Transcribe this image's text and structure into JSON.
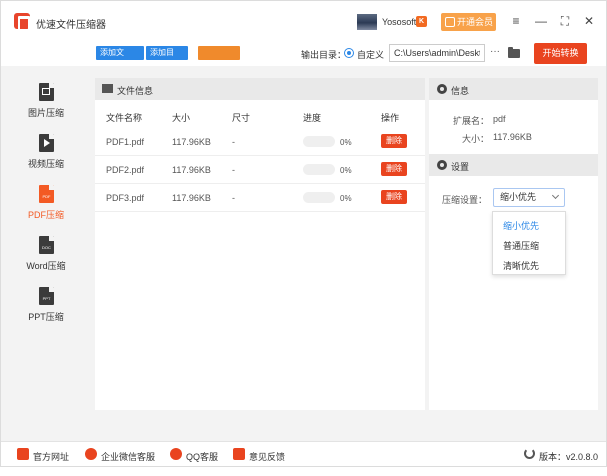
{
  "app": {
    "title": "优速文件压缩器"
  },
  "user": {
    "name": "Yososoft",
    "badge": "K",
    "vip_label": "开通会员"
  },
  "window_controls": {
    "menu": "≡",
    "minimize": "—",
    "maximize": "⛶",
    "close": "✕"
  },
  "toolbar": {
    "add_file_label": "添加文",
    "add_dir_label": "添加目",
    "clear_label": "",
    "output_label": "输出目录：",
    "radio_label": "自定义",
    "path_value": "C:\\Users\\admin\\Deskto",
    "more_label": "···",
    "start_label": "开始转换"
  },
  "sidebar": {
    "items": [
      {
        "label": "图片压缩",
        "icon_text": ""
      },
      {
        "label": "视频压缩",
        "icon_text": ""
      },
      {
        "label": "PDF压缩",
        "icon_text": "PDF"
      },
      {
        "label": "Word压缩",
        "icon_text": "DOC"
      },
      {
        "label": "PPT压缩",
        "icon_text": "PPT"
      }
    ],
    "active_index": 2
  },
  "file_panel": {
    "title": "文件信息",
    "columns": [
      "文件名称",
      "大小",
      "尺寸",
      "进度",
      "操作"
    ],
    "rows": [
      {
        "name": "PDF1.pdf",
        "size": "117.96KB",
        "dim": "-",
        "progress": "0%",
        "action": "删除"
      },
      {
        "name": "PDF2.pdf",
        "size": "117.96KB",
        "dim": "-",
        "progress": "0%",
        "action": "删除"
      },
      {
        "name": "PDF3.pdf",
        "size": "117.96KB",
        "dim": "-",
        "progress": "0%",
        "action": "删除"
      }
    ]
  },
  "info": {
    "title": "信息",
    "ext_label": "扩展名：",
    "ext_value": "pdf",
    "size_label": "大小：",
    "size_value": "117.96KB"
  },
  "settings": {
    "title": "设置",
    "compress_label": "压缩设置：",
    "selected": "缩小优先",
    "options": [
      "缩小优先",
      "普通压缩",
      "清晰优先"
    ]
  },
  "status": {
    "website": "官方网址",
    "wechat": "企业微信客服",
    "qq": "QQ客服",
    "feedback": "意见反馈",
    "version": "版本：v2.0.8.0"
  },
  "colors": {
    "accent": "#e9441f",
    "blue": "#2b87e6",
    "active_nav": "#f35a24"
  }
}
